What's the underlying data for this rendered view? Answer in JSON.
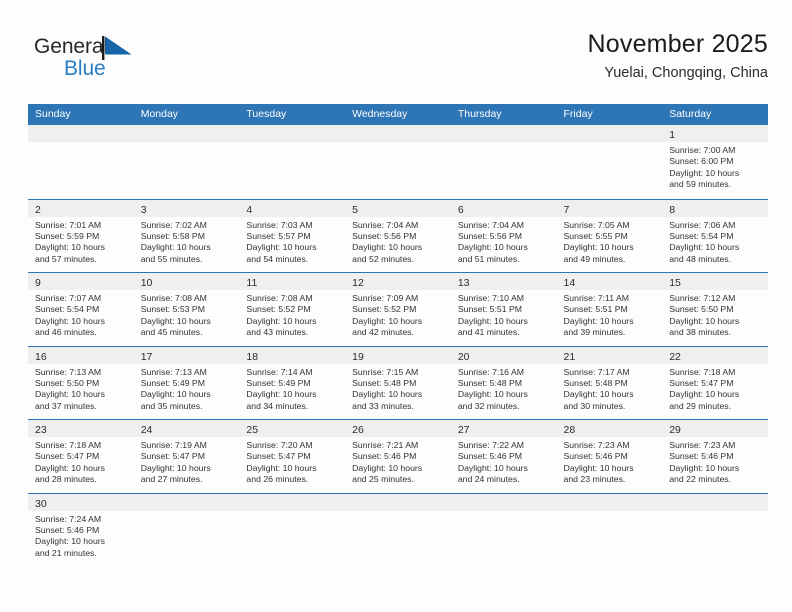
{
  "brand": {
    "name_part1": "General",
    "name_part2": "Blue",
    "flag_icon": "blue-triangle-flag-icon",
    "accent_color": "#2a7fc4"
  },
  "header": {
    "title": "November 2025",
    "subtitle": "Yuelai, Chongqing, China"
  },
  "theme": {
    "header_blue": "#2e75b6",
    "day_band_gray": "#efefef",
    "text_color": "#333333"
  },
  "weekdays": [
    "Sunday",
    "Monday",
    "Tuesday",
    "Wednesday",
    "Thursday",
    "Friday",
    "Saturday"
  ],
  "weeks": [
    [
      {
        "day": "",
        "empty": true
      },
      {
        "day": "",
        "empty": true
      },
      {
        "day": "",
        "empty": true
      },
      {
        "day": "",
        "empty": true
      },
      {
        "day": "",
        "empty": true
      },
      {
        "day": "",
        "empty": true
      },
      {
        "day": "1",
        "sunrise": "Sunrise: 7:00 AM",
        "sunset": "Sunset: 6:00 PM",
        "daylight1": "Daylight: 10 hours",
        "daylight2": "and 59 minutes."
      }
    ],
    [
      {
        "day": "2",
        "sunrise": "Sunrise: 7:01 AM",
        "sunset": "Sunset: 5:59 PM",
        "daylight1": "Daylight: 10 hours",
        "daylight2": "and 57 minutes."
      },
      {
        "day": "3",
        "sunrise": "Sunrise: 7:02 AM",
        "sunset": "Sunset: 5:58 PM",
        "daylight1": "Daylight: 10 hours",
        "daylight2": "and 55 minutes."
      },
      {
        "day": "4",
        "sunrise": "Sunrise: 7:03 AM",
        "sunset": "Sunset: 5:57 PM",
        "daylight1": "Daylight: 10 hours",
        "daylight2": "and 54 minutes."
      },
      {
        "day": "5",
        "sunrise": "Sunrise: 7:04 AM",
        "sunset": "Sunset: 5:56 PM",
        "daylight1": "Daylight: 10 hours",
        "daylight2": "and 52 minutes."
      },
      {
        "day": "6",
        "sunrise": "Sunrise: 7:04 AM",
        "sunset": "Sunset: 5:56 PM",
        "daylight1": "Daylight: 10 hours",
        "daylight2": "and 51 minutes."
      },
      {
        "day": "7",
        "sunrise": "Sunrise: 7:05 AM",
        "sunset": "Sunset: 5:55 PM",
        "daylight1": "Daylight: 10 hours",
        "daylight2": "and 49 minutes."
      },
      {
        "day": "8",
        "sunrise": "Sunrise: 7:06 AM",
        "sunset": "Sunset: 5:54 PM",
        "daylight1": "Daylight: 10 hours",
        "daylight2": "and 48 minutes."
      }
    ],
    [
      {
        "day": "9",
        "sunrise": "Sunrise: 7:07 AM",
        "sunset": "Sunset: 5:54 PM",
        "daylight1": "Daylight: 10 hours",
        "daylight2": "and 46 minutes."
      },
      {
        "day": "10",
        "sunrise": "Sunrise: 7:08 AM",
        "sunset": "Sunset: 5:53 PM",
        "daylight1": "Daylight: 10 hours",
        "daylight2": "and 45 minutes."
      },
      {
        "day": "11",
        "sunrise": "Sunrise: 7:08 AM",
        "sunset": "Sunset: 5:52 PM",
        "daylight1": "Daylight: 10 hours",
        "daylight2": "and 43 minutes."
      },
      {
        "day": "12",
        "sunrise": "Sunrise: 7:09 AM",
        "sunset": "Sunset: 5:52 PM",
        "daylight1": "Daylight: 10 hours",
        "daylight2": "and 42 minutes."
      },
      {
        "day": "13",
        "sunrise": "Sunrise: 7:10 AM",
        "sunset": "Sunset: 5:51 PM",
        "daylight1": "Daylight: 10 hours",
        "daylight2": "and 41 minutes."
      },
      {
        "day": "14",
        "sunrise": "Sunrise: 7:11 AM",
        "sunset": "Sunset: 5:51 PM",
        "daylight1": "Daylight: 10 hours",
        "daylight2": "and 39 minutes."
      },
      {
        "day": "15",
        "sunrise": "Sunrise: 7:12 AM",
        "sunset": "Sunset: 5:50 PM",
        "daylight1": "Daylight: 10 hours",
        "daylight2": "and 38 minutes."
      }
    ],
    [
      {
        "day": "16",
        "sunrise": "Sunrise: 7:13 AM",
        "sunset": "Sunset: 5:50 PM",
        "daylight1": "Daylight: 10 hours",
        "daylight2": "and 37 minutes."
      },
      {
        "day": "17",
        "sunrise": "Sunrise: 7:13 AM",
        "sunset": "Sunset: 5:49 PM",
        "daylight1": "Daylight: 10 hours",
        "daylight2": "and 35 minutes."
      },
      {
        "day": "18",
        "sunrise": "Sunrise: 7:14 AM",
        "sunset": "Sunset: 5:49 PM",
        "daylight1": "Daylight: 10 hours",
        "daylight2": "and 34 minutes."
      },
      {
        "day": "19",
        "sunrise": "Sunrise: 7:15 AM",
        "sunset": "Sunset: 5:48 PM",
        "daylight1": "Daylight: 10 hours",
        "daylight2": "and 33 minutes."
      },
      {
        "day": "20",
        "sunrise": "Sunrise: 7:16 AM",
        "sunset": "Sunset: 5:48 PM",
        "daylight1": "Daylight: 10 hours",
        "daylight2": "and 32 minutes."
      },
      {
        "day": "21",
        "sunrise": "Sunrise: 7:17 AM",
        "sunset": "Sunset: 5:48 PM",
        "daylight1": "Daylight: 10 hours",
        "daylight2": "and 30 minutes."
      },
      {
        "day": "22",
        "sunrise": "Sunrise: 7:18 AM",
        "sunset": "Sunset: 5:47 PM",
        "daylight1": "Daylight: 10 hours",
        "daylight2": "and 29 minutes."
      }
    ],
    [
      {
        "day": "23",
        "sunrise": "Sunrise: 7:18 AM",
        "sunset": "Sunset: 5:47 PM",
        "daylight1": "Daylight: 10 hours",
        "daylight2": "and 28 minutes."
      },
      {
        "day": "24",
        "sunrise": "Sunrise: 7:19 AM",
        "sunset": "Sunset: 5:47 PM",
        "daylight1": "Daylight: 10 hours",
        "daylight2": "and 27 minutes."
      },
      {
        "day": "25",
        "sunrise": "Sunrise: 7:20 AM",
        "sunset": "Sunset: 5:47 PM",
        "daylight1": "Daylight: 10 hours",
        "daylight2": "and 26 minutes."
      },
      {
        "day": "26",
        "sunrise": "Sunrise: 7:21 AM",
        "sunset": "Sunset: 5:46 PM",
        "daylight1": "Daylight: 10 hours",
        "daylight2": "and 25 minutes."
      },
      {
        "day": "27",
        "sunrise": "Sunrise: 7:22 AM",
        "sunset": "Sunset: 5:46 PM",
        "daylight1": "Daylight: 10 hours",
        "daylight2": "and 24 minutes."
      },
      {
        "day": "28",
        "sunrise": "Sunrise: 7:23 AM",
        "sunset": "Sunset: 5:46 PM",
        "daylight1": "Daylight: 10 hours",
        "daylight2": "and 23 minutes."
      },
      {
        "day": "29",
        "sunrise": "Sunrise: 7:23 AM",
        "sunset": "Sunset: 5:46 PM",
        "daylight1": "Daylight: 10 hours",
        "daylight2": "and 22 minutes."
      }
    ],
    [
      {
        "day": "30",
        "sunrise": "Sunrise: 7:24 AM",
        "sunset": "Sunset: 5:46 PM",
        "daylight1": "Daylight: 10 hours",
        "daylight2": "and 21 minutes."
      },
      {
        "day": "",
        "empty": true
      },
      {
        "day": "",
        "empty": true
      },
      {
        "day": "",
        "empty": true
      },
      {
        "day": "",
        "empty": true
      },
      {
        "day": "",
        "empty": true
      },
      {
        "day": "",
        "empty": true
      }
    ]
  ]
}
